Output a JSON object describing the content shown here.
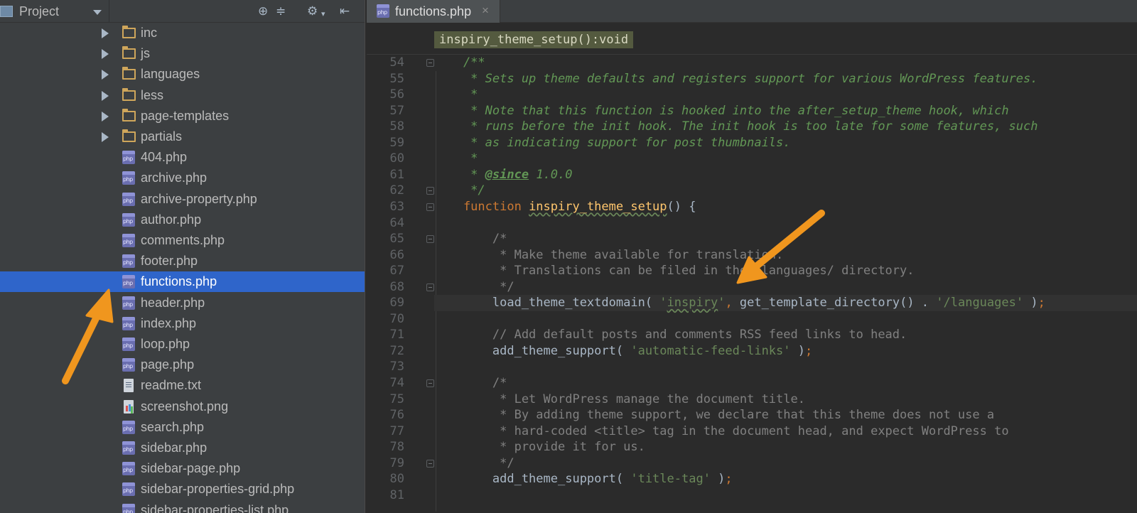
{
  "project_panel": {
    "title": "Project",
    "tree": [
      {
        "label": "inc",
        "type": "folder"
      },
      {
        "label": "js",
        "type": "folder"
      },
      {
        "label": "languages",
        "type": "folder"
      },
      {
        "label": "less",
        "type": "folder"
      },
      {
        "label": "page-templates",
        "type": "folder"
      },
      {
        "label": "partials",
        "type": "folder"
      },
      {
        "label": "404.php",
        "type": "php"
      },
      {
        "label": "archive.php",
        "type": "php"
      },
      {
        "label": "archive-property.php",
        "type": "php"
      },
      {
        "label": "author.php",
        "type": "php"
      },
      {
        "label": "comments.php",
        "type": "php"
      },
      {
        "label": "footer.php",
        "type": "php"
      },
      {
        "label": "functions.php",
        "type": "php",
        "selected": true
      },
      {
        "label": "header.php",
        "type": "php"
      },
      {
        "label": "index.php",
        "type": "php"
      },
      {
        "label": "loop.php",
        "type": "php"
      },
      {
        "label": "page.php",
        "type": "php"
      },
      {
        "label": "readme.txt",
        "type": "txt"
      },
      {
        "label": "screenshot.png",
        "type": "png"
      },
      {
        "label": "search.php",
        "type": "php"
      },
      {
        "label": "sidebar.php",
        "type": "php"
      },
      {
        "label": "sidebar-page.php",
        "type": "php"
      },
      {
        "label": "sidebar-properties-grid.php",
        "type": "php"
      },
      {
        "label": "sidebar-properties-list.php",
        "type": "php"
      }
    ]
  },
  "editor": {
    "tab_label": "functions.php",
    "tab_close": "×",
    "breadcrumb": "inspiry_theme_setup():void",
    "current_line": 69,
    "lines": [
      {
        "n": "54",
        "tokens": [
          [
            "doc",
            "    /**"
          ]
        ]
      },
      {
        "n": "55",
        "tokens": [
          [
            "doc",
            "     * Sets up theme defaults and registers support for various WordPress features."
          ]
        ]
      },
      {
        "n": "56",
        "tokens": [
          [
            "doc",
            "     *"
          ]
        ]
      },
      {
        "n": "57",
        "tokens": [
          [
            "doc",
            "     * Note that this function is hooked into the after_setup_theme hook, which"
          ]
        ]
      },
      {
        "n": "58",
        "tokens": [
          [
            "doc",
            "     * runs before the init hook. The init hook is too late for some features, such"
          ]
        ]
      },
      {
        "n": "59",
        "tokens": [
          [
            "doc",
            "     * as indicating support for post thumbnails."
          ]
        ]
      },
      {
        "n": "60",
        "tokens": [
          [
            "doc",
            "     *"
          ]
        ]
      },
      {
        "n": "61",
        "tokens": [
          [
            "doc",
            "     * "
          ],
          [
            "doctag",
            "@since"
          ],
          [
            "doc",
            " 1.0.0"
          ]
        ]
      },
      {
        "n": "62",
        "tokens": [
          [
            "doc",
            "     */"
          ]
        ]
      },
      {
        "n": "63",
        "tokens": [
          [
            "kw",
            "    function "
          ],
          [
            "fnw",
            "inspiry_theme_setup"
          ],
          [
            "plain",
            "() {"
          ]
        ]
      },
      {
        "n": "64",
        "tokens": [
          [
            "plain",
            ""
          ]
        ]
      },
      {
        "n": "65",
        "tokens": [
          [
            "cmt",
            "        /*"
          ]
        ]
      },
      {
        "n": "66",
        "tokens": [
          [
            "cmt",
            "         * Make theme available for translation."
          ]
        ]
      },
      {
        "n": "67",
        "tokens": [
          [
            "cmt",
            "         * Translations can be filed in the /languages/ directory."
          ]
        ]
      },
      {
        "n": "68",
        "tokens": [
          [
            "cmt",
            "         */"
          ]
        ]
      },
      {
        "n": "69",
        "tokens": [
          [
            "plain",
            "        load_theme_textdomain( "
          ],
          [
            "str",
            "'"
          ],
          [
            "strw",
            "inspiry"
          ],
          [
            "str",
            "'"
          ],
          [
            "punc",
            ","
          ],
          [
            "plain",
            " get_template_directory() . "
          ],
          [
            "str",
            "'/languages'"
          ],
          [
            "plain",
            " )"
          ],
          [
            "punc",
            ";"
          ]
        ]
      },
      {
        "n": "70",
        "tokens": [
          [
            "plain",
            ""
          ]
        ]
      },
      {
        "n": "71",
        "tokens": [
          [
            "cmt",
            "        // Add default posts and comments RSS feed links to head."
          ]
        ]
      },
      {
        "n": "72",
        "tokens": [
          [
            "plain",
            "        add_theme_support( "
          ],
          [
            "str",
            "'automatic-feed-links'"
          ],
          [
            "plain",
            " )"
          ],
          [
            "punc",
            ";"
          ]
        ]
      },
      {
        "n": "73",
        "tokens": [
          [
            "plain",
            ""
          ]
        ]
      },
      {
        "n": "74",
        "tokens": [
          [
            "cmt",
            "        /*"
          ]
        ]
      },
      {
        "n": "75",
        "tokens": [
          [
            "cmt",
            "         * Let WordPress manage the document title."
          ]
        ]
      },
      {
        "n": "76",
        "tokens": [
          [
            "cmt",
            "         * By adding theme support, we declare that this theme does not use a"
          ]
        ]
      },
      {
        "n": "77",
        "tokens": [
          [
            "cmt",
            "         * hard-coded <title> tag in the document head, and expect WordPress to"
          ]
        ]
      },
      {
        "n": "78",
        "tokens": [
          [
            "cmt",
            "         * provide it for us."
          ]
        ]
      },
      {
        "n": "79",
        "tokens": [
          [
            "cmt",
            "         */"
          ]
        ]
      },
      {
        "n": "80",
        "tokens": [
          [
            "plain",
            "        add_theme_support( "
          ],
          [
            "str",
            "'title-tag'"
          ],
          [
            "plain",
            " )"
          ],
          [
            "punc",
            ";"
          ]
        ]
      },
      {
        "n": "81",
        "tokens": [
          [
            "plain",
            ""
          ]
        ]
      }
    ],
    "fold_markers": [
      "54",
      "62",
      "63",
      "65",
      "68",
      "74",
      "79"
    ]
  },
  "colors": {
    "selection": "#2f65ca",
    "annotation_arrow": "#f0961e",
    "keyword": "#cc7832",
    "function_name": "#ffc66d",
    "string": "#6a8759",
    "doc_comment": "#629755",
    "comment": "#808080"
  }
}
